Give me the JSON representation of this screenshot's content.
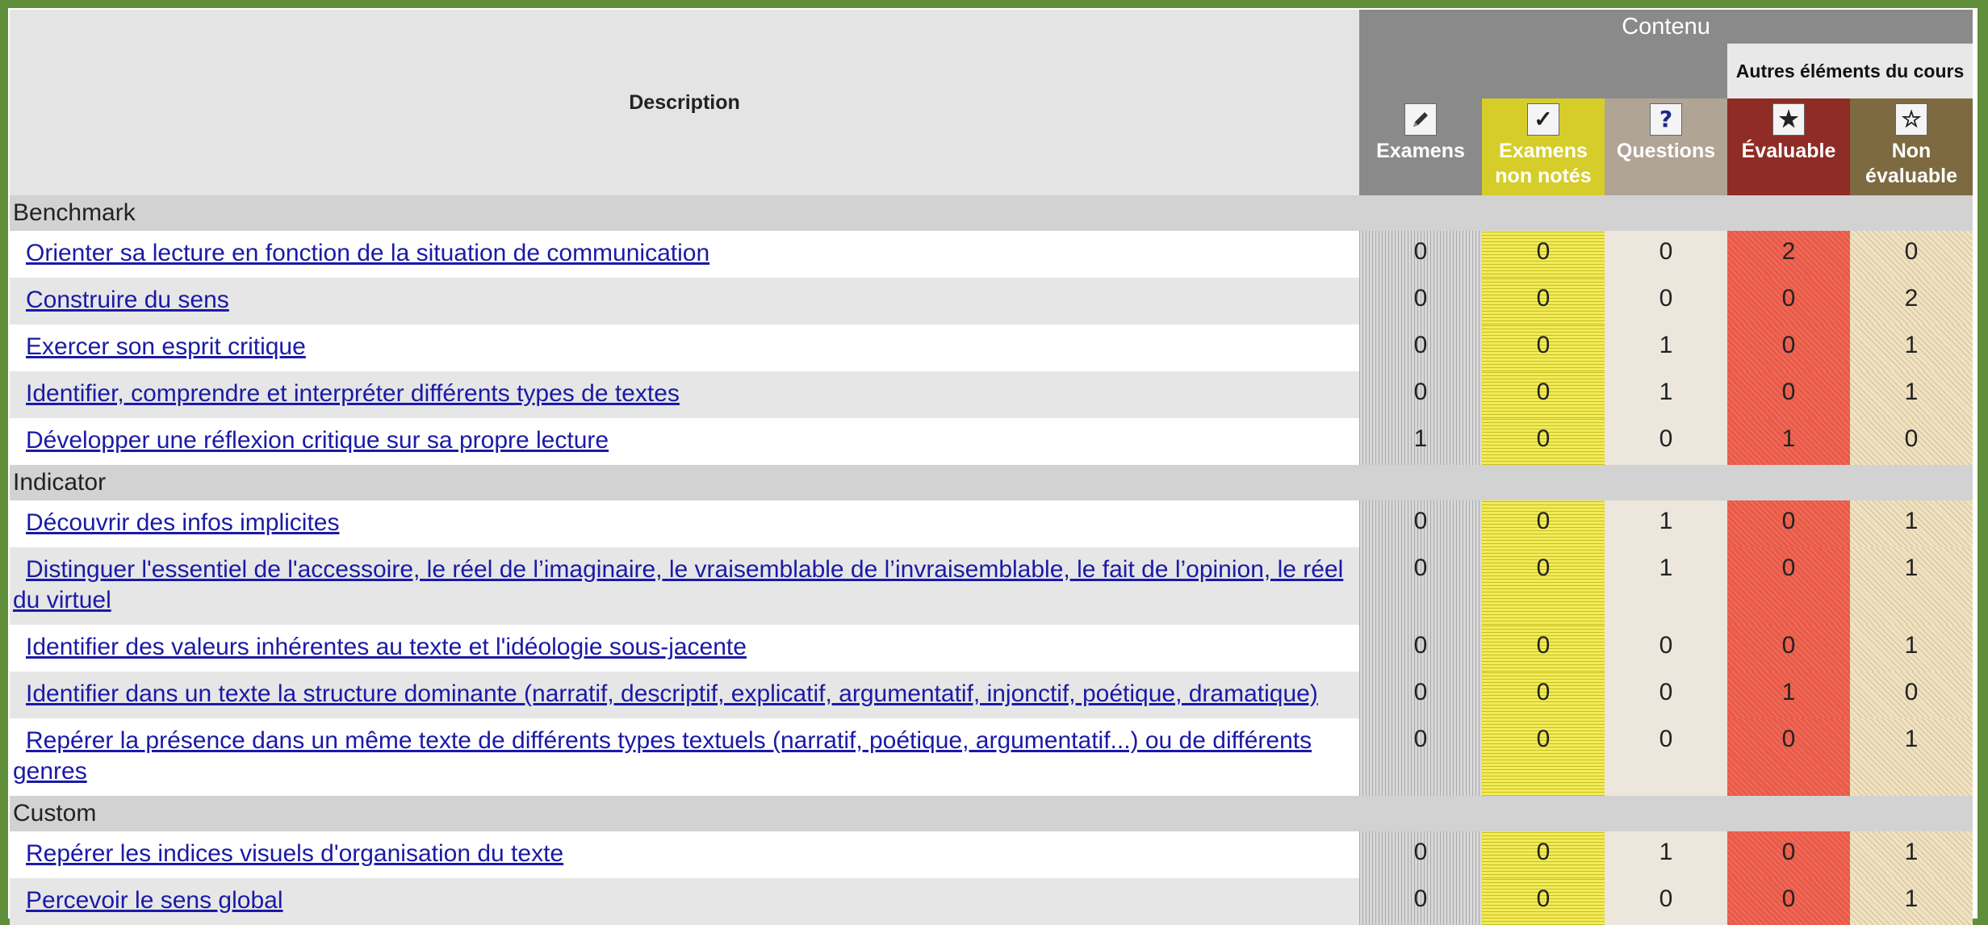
{
  "header": {
    "description": "Description",
    "contenu": "Contenu",
    "autres": "Autres éléments du cours",
    "columns": [
      {
        "label": "Examens",
        "icon": "pencil-icon"
      },
      {
        "label": "Examens non notés",
        "icon": "checkmark-icon"
      },
      {
        "label": "Questions",
        "icon": "question-mark-icon"
      },
      {
        "label": "Évaluable",
        "icon": "filled-star-icon"
      },
      {
        "label": "Non évaluable",
        "icon": "outline-star-icon"
      }
    ]
  },
  "colors": {
    "examens": "#8a8a8a",
    "examens_non_notes": "#d6cd2a",
    "questions": "#b0a495",
    "evaluable": "#8e2c25",
    "non_evaluable": "#7d6a40",
    "link": "#1a1aa6"
  },
  "sections": [
    {
      "title": "Benchmark",
      "rows": [
        {
          "text": "Orienter sa lecture en fonction de la situation de communication",
          "values": [
            "0",
            "0",
            "0",
            "2",
            "0"
          ]
        },
        {
          "text": "Construire du sens",
          "values": [
            "0",
            "0",
            "0",
            "0",
            "2"
          ]
        },
        {
          "text": "Exercer son esprit critique",
          "values": [
            "0",
            "0",
            "1",
            "0",
            "1"
          ]
        },
        {
          "text": "Identifier, comprendre et interpréter différents types de textes",
          "values": [
            "0",
            "0",
            "1",
            "0",
            "1"
          ]
        },
        {
          "text": "Développer une réflexion critique sur sa propre lecture",
          "values": [
            "1",
            "0",
            "0",
            "1",
            "0"
          ]
        }
      ]
    },
    {
      "title": "Indicator",
      "rows": [
        {
          "text": "Découvrir des infos implicites",
          "values": [
            "0",
            "0",
            "1",
            "0",
            "1"
          ]
        },
        {
          "text": "Distinguer l'essentiel de l'accessoire, le réel de l’imaginaire, le vraisemblable de l’invraisemblable, le fait de l’opinion, le réel du virtuel",
          "values": [
            "0",
            "0",
            "1",
            "0",
            "1"
          ]
        },
        {
          "text": "Identifier des valeurs inhérentes au texte et l'idéologie sous-jacente",
          "values": [
            "0",
            "0",
            "0",
            "0",
            "1"
          ]
        },
        {
          "text": "Identifier dans un texte la structure dominante (narratif, descriptif, explicatif, argumentatif, injonctif,  poétique, dramatique)",
          "values": [
            "0",
            "0",
            "0",
            "1",
            "0"
          ]
        },
        {
          "text": "Repérer la présence dans un même texte de différents types textuels (narratif, poétique, argumentatif...) ou de différents genres",
          "values": [
            "0",
            "0",
            "0",
            "0",
            "1"
          ]
        }
      ]
    },
    {
      "title": "Custom",
      "rows": [
        {
          "text": "Repérer les indices visuels d'organisation du texte ",
          "values": [
            "0",
            "0",
            "1",
            "0",
            "1"
          ]
        },
        {
          "text": "Percevoir le sens global",
          "values": [
            "0",
            "0",
            "0",
            "0",
            "1"
          ]
        }
      ]
    }
  ]
}
